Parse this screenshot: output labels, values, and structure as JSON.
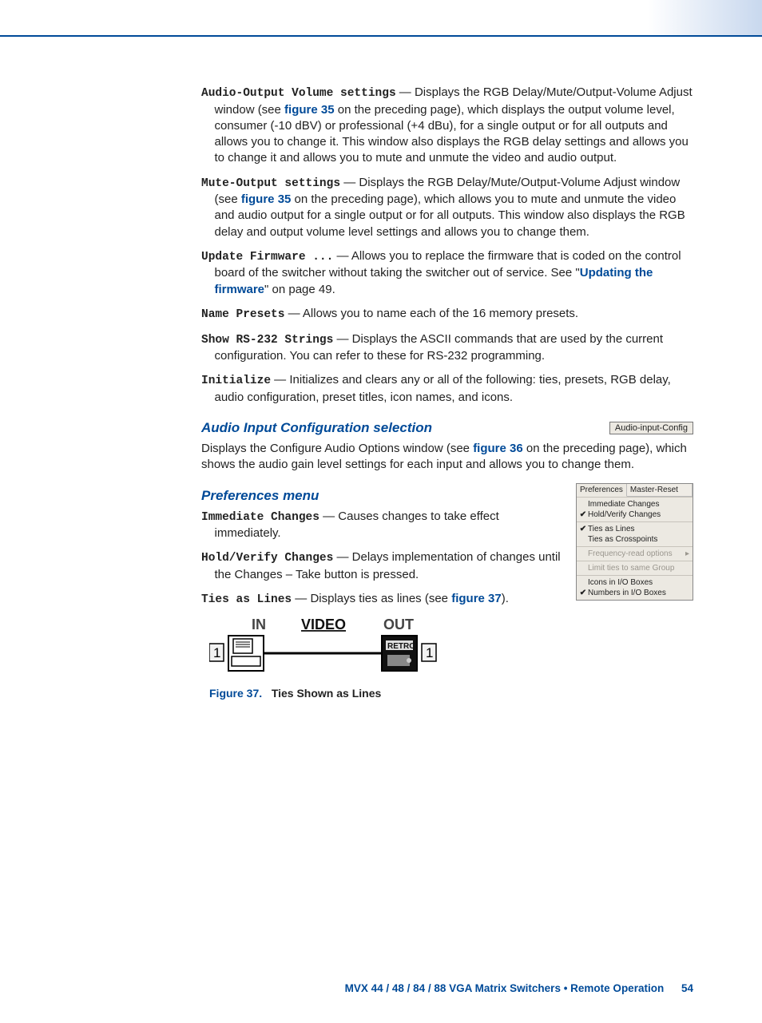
{
  "items": [
    {
      "term": "Audio-Output Volume settings",
      "pre": " — Displays the RGB Delay/Mute/Output-Volume Adjust window (see ",
      "link": "figure 35",
      "post": " on the preceding page), which displays the output volume level, consumer (-10 dBV) or professional (+4 dBu), for a single output or for all outputs and allows you to change it. This window also displays the RGB delay settings and allows you to change it and allows you to mute and unmute the video and audio output."
    },
    {
      "term": "Mute-Output settings",
      "pre": " — Displays the RGB Delay/Mute/Output-Volume Adjust window (see ",
      "link": "figure 35",
      "post": " on the preceding page), which allows you to mute and unmute the video and audio output for a single output or for all outputs. This window also displays the RGB delay and output volume level settings and allows you to change them."
    },
    {
      "term": "Update Firmware ...",
      "pre": " — Allows you to replace the firmware that is coded on the control board of the switcher without taking the switcher out of service. See \"",
      "link": "Updating the firmware",
      "post": "\" on page 49."
    },
    {
      "term": "Name Presets",
      "pre": " — Allows you to name each of the 16 memory presets.",
      "link": "",
      "post": ""
    },
    {
      "term": "Show RS-232 Strings",
      "pre": " — Displays the ASCII commands that are used by the current configuration. You can refer to these for RS-232 programming.",
      "link": "",
      "post": ""
    },
    {
      "term": "Initialize",
      "pre": " — Initializes and clears any or all of the following: ties, presets, RGB delay, audio configuration, preset titles, icon names, and icons.",
      "link": "",
      "post": ""
    }
  ],
  "h_audio": "Audio Input Configuration selection",
  "audio_btn": "Audio-input-Config",
  "audio_para_pre": "Displays the Configure Audio Options window (see ",
  "audio_link": "figure 36",
  "audio_para_post": " on the preceding page), which shows the audio gain level settings for each input and allows you to change them.",
  "h_pref": "Preferences menu",
  "pref_items": [
    {
      "term": "Immediate Changes",
      "text": " — Causes changes to take effect immediately."
    },
    {
      "term": "Hold/Verify Changes",
      "text": " — Delays implementation of changes until the Changes – Take button is pressed."
    }
  ],
  "ties_term": "Ties as Lines",
  "ties_pre": " — Displays ties as lines (see ",
  "ties_link": "figure 37",
  "ties_post": ").",
  "pref_menu": {
    "tabs": [
      "Preferences",
      "Master-Reset"
    ],
    "rows": [
      {
        "chk": "",
        "label": "Immediate Changes",
        "disabled": false,
        "grp": 0
      },
      {
        "chk": "✔",
        "label": "Hold/Verify Changes",
        "disabled": false,
        "grp": 0
      },
      {
        "chk": "✔",
        "label": "Ties as Lines",
        "disabled": false,
        "grp": 1
      },
      {
        "chk": "",
        "label": "Ties as Crosspoints",
        "disabled": false,
        "grp": 1
      },
      {
        "chk": "",
        "label": "Frequency-read options",
        "disabled": true,
        "arrow": "▸",
        "grp": 2
      },
      {
        "chk": "",
        "label": "Limit ties to same Group",
        "disabled": true,
        "grp": 3
      },
      {
        "chk": "",
        "label": "Icons in I/O Boxes",
        "disabled": false,
        "grp": 4
      },
      {
        "chk": "✔",
        "label": "Numbers in I/O Boxes",
        "disabled": false,
        "grp": 4
      }
    ]
  },
  "figure": {
    "in": "IN",
    "video": "VIDEO",
    "out": "OUT",
    "num": "1",
    "retro": "RETRO",
    "caption_num": "Figure 37.",
    "caption_txt": "Ties Shown as Lines"
  },
  "footer": {
    "text": "MVX 44 / 48 / 84 / 88 VGA Matrix Switchers • Remote Operation",
    "page": "54"
  }
}
